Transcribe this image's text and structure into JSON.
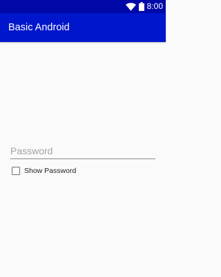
{
  "status_bar": {
    "time": "8:00",
    "background": "#0008a8",
    "icons": [
      "wifi-icon",
      "battery-icon"
    ]
  },
  "app_bar": {
    "title": "Basic Android",
    "background": "#0016cc"
  },
  "form": {
    "password_placeholder": "Password",
    "password_value": "",
    "show_password_label": "Show Password",
    "show_password_checked": false
  }
}
